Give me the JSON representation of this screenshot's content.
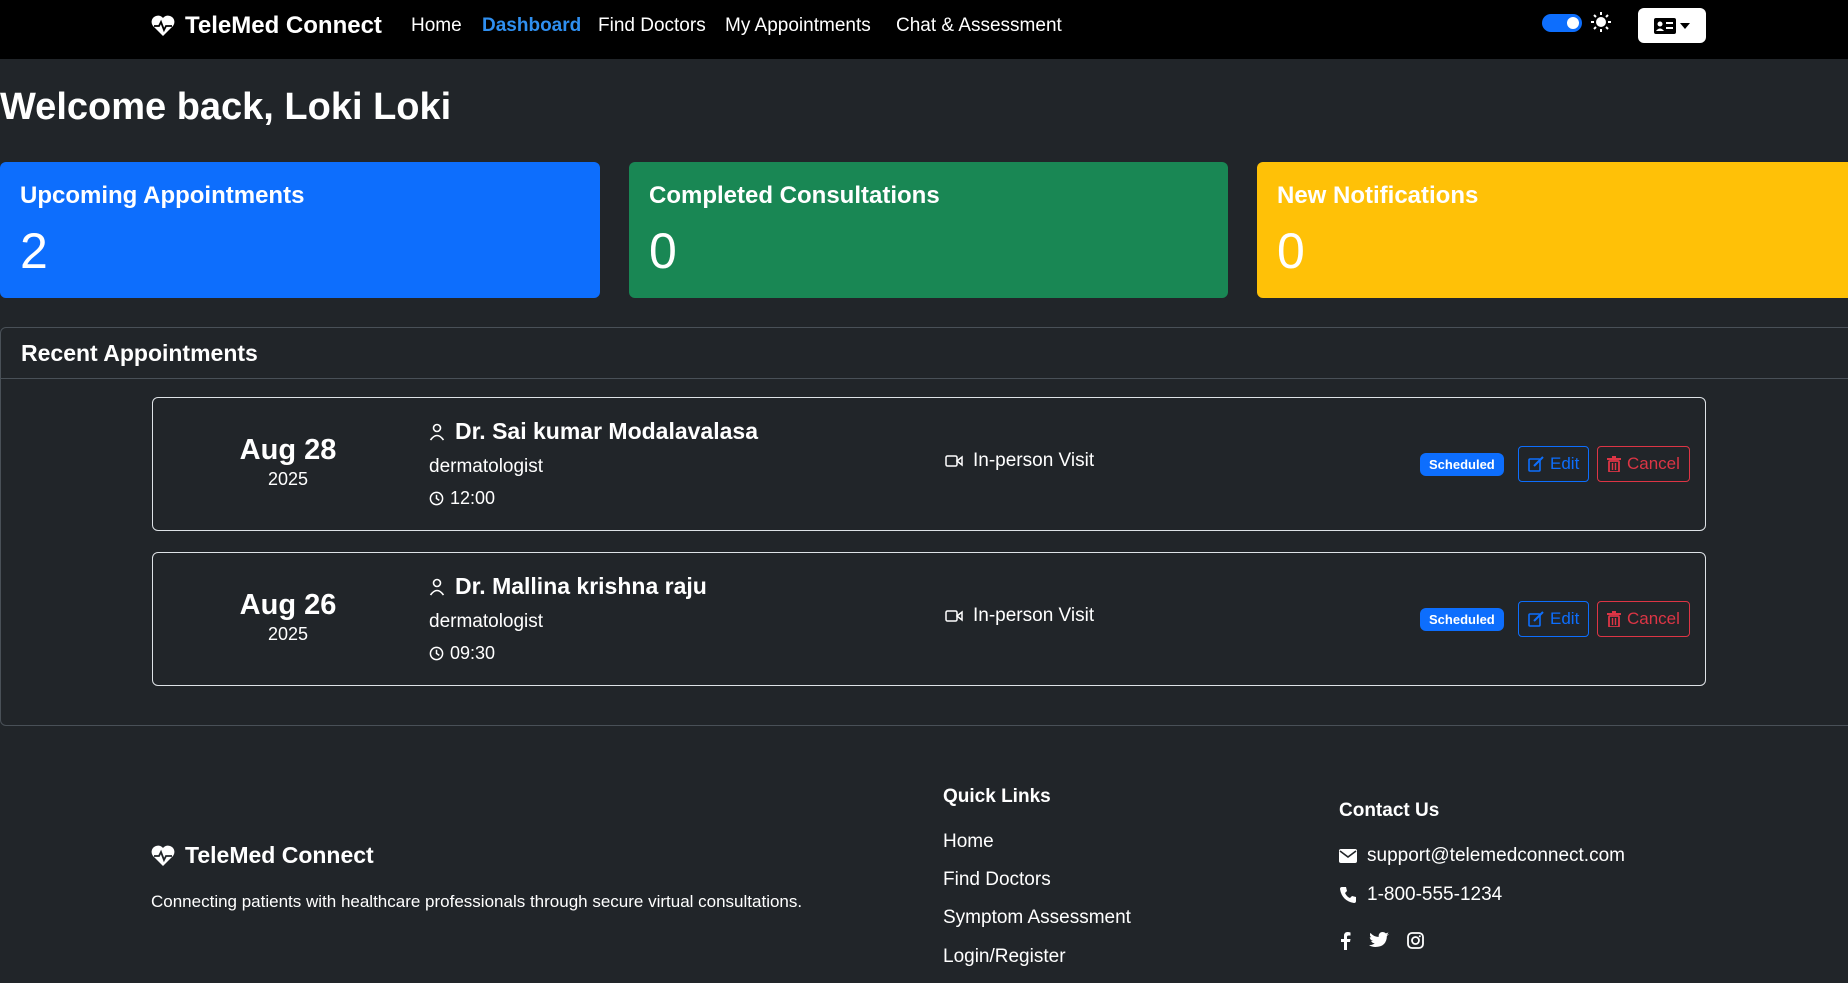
{
  "nav": {
    "brand": "TeleMed Connect",
    "links": [
      "Home",
      "Dashboard",
      "Find Doctors",
      "My Appointments",
      "Chat & Assessment"
    ],
    "active_link": "Dashboard"
  },
  "welcome": "Welcome back, Loki Loki",
  "stats": [
    {
      "label": "Upcoming Appointments",
      "value": "2",
      "color": "#0d6efd"
    },
    {
      "label": "Completed Consultations",
      "value": "0",
      "color": "#198754"
    },
    {
      "label": "New Notifications",
      "value": "0",
      "color": "#ffc107"
    }
  ],
  "recent": {
    "title": "Recent Appointments",
    "appointments": [
      {
        "month_day": "Aug 28",
        "year": "2025",
        "doctor": "Dr. Sai kumar Modalavalasa",
        "specialty": "dermatologist",
        "time": "12:00",
        "visit_type": "In-person Visit",
        "status": "Scheduled",
        "edit_label": "Edit",
        "cancel_label": "Cancel"
      },
      {
        "month_day": "Aug 26",
        "year": "2025",
        "doctor": "Dr. Mallina krishna raju",
        "specialty": "dermatologist",
        "time": "09:30",
        "visit_type": "In-person Visit",
        "status": "Scheduled",
        "edit_label": "Edit",
        "cancel_label": "Cancel"
      }
    ]
  },
  "footer": {
    "brand": "TeleMed Connect",
    "tagline": "Connecting patients with healthcare professionals through secure virtual consultations.",
    "quick_links_title": "Quick Links",
    "quick_links": [
      "Home",
      "Find Doctors",
      "Symptom Assessment",
      "Login/Register"
    ],
    "contact_title": "Contact Us",
    "email": "support@telemedconnect.com",
    "phone": "1-800-555-1234",
    "social": [
      "facebook-icon",
      "twitter-icon",
      "instagram-icon"
    ]
  },
  "colors": {
    "accent": "#0d6efd",
    "danger": "#dc3545",
    "active_nav": "#2f8ff0"
  }
}
